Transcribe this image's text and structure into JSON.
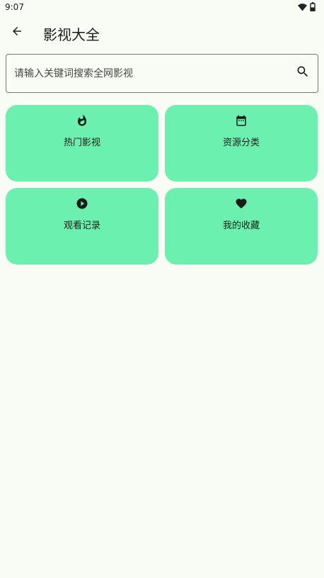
{
  "status": {
    "time": "9:07",
    "icons": [
      "wifi-icon",
      "battery-icon"
    ]
  },
  "header": {
    "back_icon": "arrow-left-icon",
    "title": "影视大全"
  },
  "search": {
    "placeholder": "请输入关键词搜索全网影视",
    "value": "",
    "icon": "search-icon"
  },
  "cards": [
    {
      "label": "热门影视",
      "icon": "fire-icon"
    },
    {
      "label": "资源分类",
      "icon": "calendar-icon"
    },
    {
      "label": "观看记录",
      "icon": "play-circle-icon"
    },
    {
      "label": "我的收藏",
      "icon": "heart-icon"
    }
  ],
  "colors": {
    "background": "#f9fbf5",
    "card": "#6cf0b0",
    "text": "#1b1c19"
  }
}
